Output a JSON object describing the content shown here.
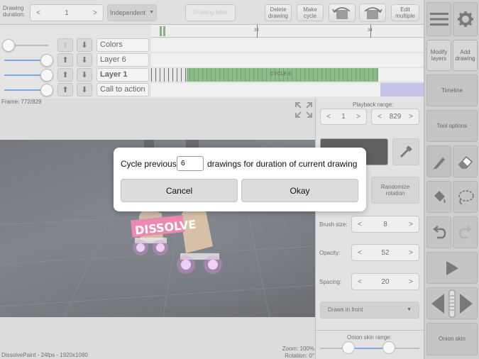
{
  "toolbar": {
    "duration_label": "Drawing\nduration:",
    "duration_value": "1",
    "mode_label": "Independent",
    "drawing_label": "Drawing label",
    "delete_drawing": "Delete\ndrawing",
    "make_cycle": "Make\ncycle",
    "edit_multiple": "Edit\nmultiple"
  },
  "ruler": {
    "marks": [
      "33",
      "34"
    ]
  },
  "layers": [
    {
      "name": "Colors",
      "bold": false
    },
    {
      "name": "Layer 6",
      "bold": false
    },
    {
      "name": "Layer 1",
      "bold": true,
      "cycle_label": "CYCLE 6"
    },
    {
      "name": "Call to action",
      "bold": false
    }
  ],
  "canvas": {
    "frame": "Frame: 772/829",
    "sign_text": "DISSOLVE",
    "status": "DissolvePaint - 24fps - 1920x1080",
    "zoom": "Zoom: 100%",
    "rotation": "Rotation: 0°"
  },
  "tools": {
    "playback_label": "Playback range:",
    "playback_start": "1",
    "playback_end": "829",
    "randomize": "Randomize\nrotation",
    "brush_label": "Brush size:",
    "brush_value": "8",
    "opacity_label": "Opacity:",
    "opacity_value": "52",
    "spacing_label": "Spacing:",
    "spacing_value": "20",
    "draw_mode": "Draws in front",
    "onion_label": "Onion skin range:"
  },
  "sidebar": {
    "modify_layers": "Modify\nlayers",
    "add_drawing": "Add\ndrawing",
    "timeline": "Timeline",
    "tool_options": "Tool options",
    "onion_skin": "Onion skin"
  },
  "dialog": {
    "prefix": "Cycle previous",
    "value": "6",
    "suffix": "drawings for duration of current drawing",
    "cancel": "Cancel",
    "okay": "Okay"
  }
}
